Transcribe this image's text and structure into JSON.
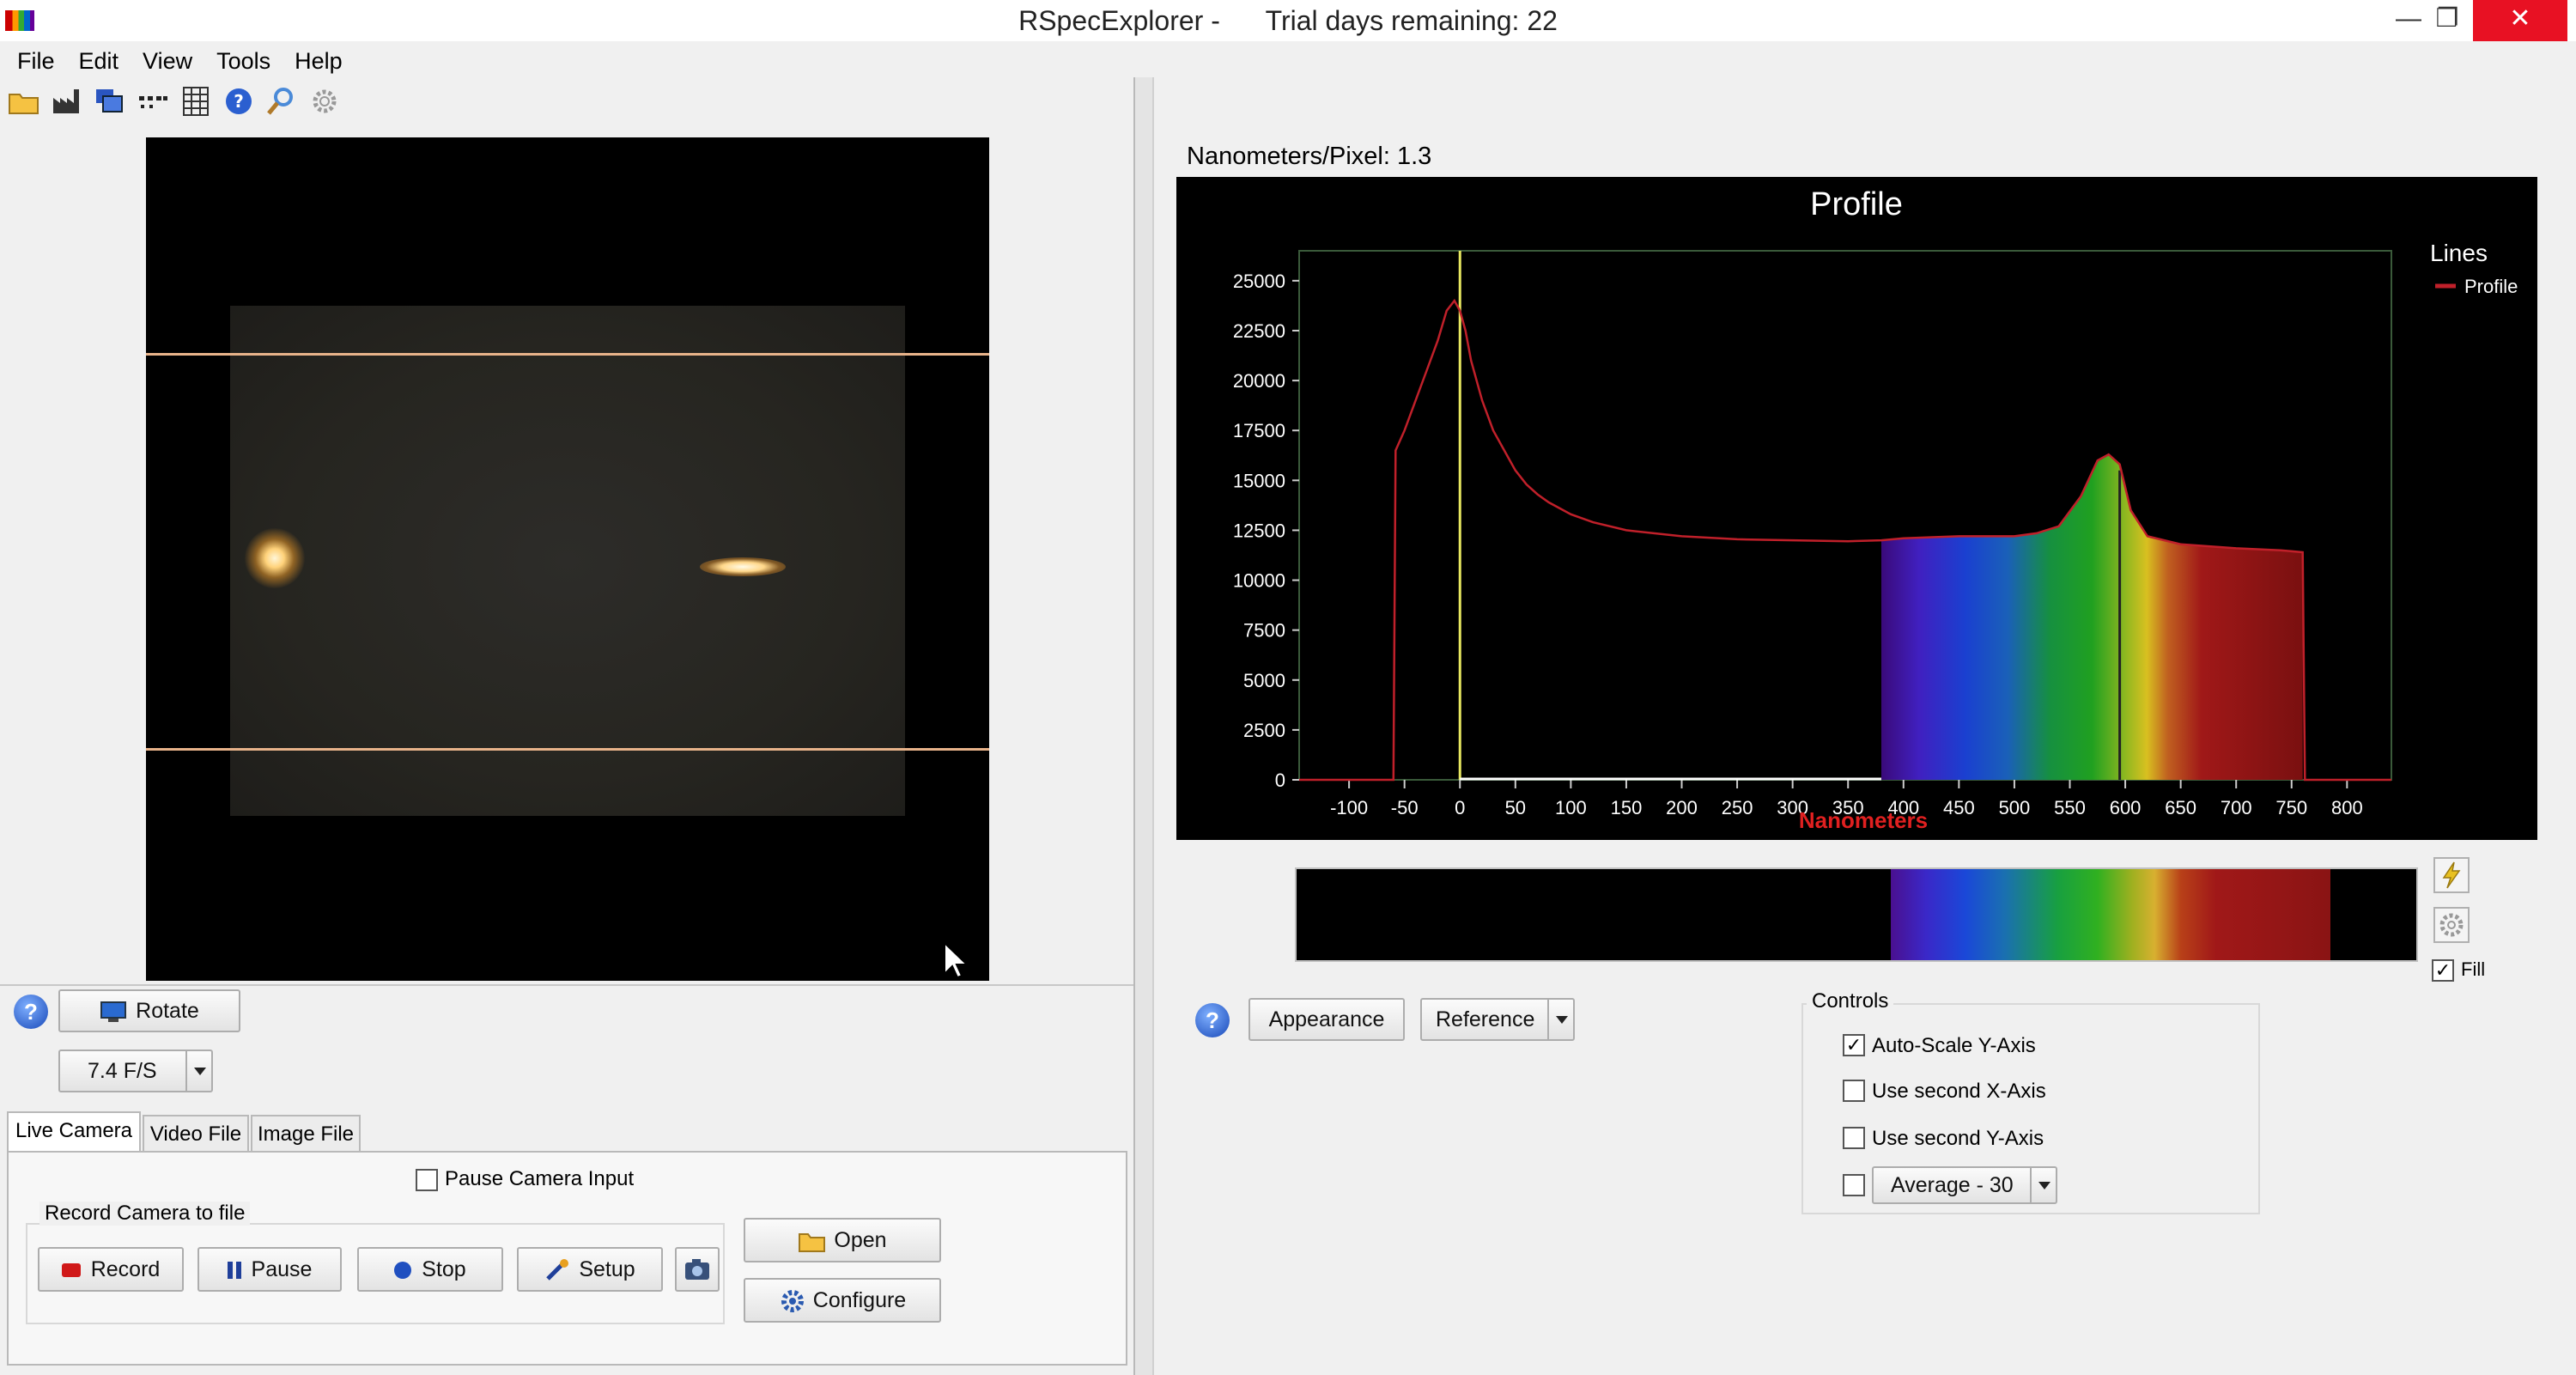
{
  "window": {
    "title": "RSpecExplorer -      Trial days remaining: 22",
    "minimize": "—",
    "maximize": "❐",
    "close": "✕"
  },
  "menu": [
    "File",
    "Edit",
    "View",
    "Tools",
    "Help"
  ],
  "left_toolbar_icons": [
    "open-folder-icon",
    "factory-icon",
    "copy-windows-icon",
    "dotted-line-icon",
    "grid-icon",
    "help-icon",
    "magnifier-icon",
    "gear-icon"
  ],
  "right_toolbar_icons": [
    "open-folder-icon",
    "dropdown-arrow-icon",
    "save-icon",
    "crosshair-icon",
    "copy-icon",
    "print-icon",
    "export-icon",
    "columns-icon",
    "vertical-arrows-icon",
    "triangle-marker-icon"
  ],
  "camera": {
    "rotate_label": "Rotate",
    "fps_value": "7.4 F/S",
    "tabs": [
      "Live Camera",
      "Video File",
      "Image File"
    ],
    "pause_input_label": "Pause Camera Input",
    "record_group_title": "Record Camera to file",
    "record_label": "Record",
    "pause_label": "Pause",
    "stop_label": "Stop",
    "setup_label": "Setup",
    "open_label": "Open",
    "configure_label": "Configure"
  },
  "profile": {
    "scale_label": "Nanometers/Pixel: 1.3",
    "appearance_label": "Appearance",
    "reference_label": "Reference",
    "fill_label": "Fill",
    "controls_title": "Controls",
    "controls": [
      {
        "label": "Auto-Scale Y-Axis",
        "checked": true
      },
      {
        "label": "Use second X-Axis",
        "checked": false
      },
      {
        "label": "Use second Y-Axis",
        "checked": false
      }
    ],
    "average_value": "Average - 30"
  },
  "chart_data": {
    "type": "line",
    "title": "Profile",
    "xlabel": "Nanometers",
    "ylabel": "",
    "xlim": [
      -145,
      840
    ],
    "ylim": [
      0,
      26500
    ],
    "x_ticks": [
      -100,
      -50,
      0,
      50,
      100,
      150,
      200,
      250,
      300,
      350,
      400,
      450,
      500,
      550,
      600,
      650,
      700,
      750,
      800
    ],
    "y_ticks": [
      0,
      2500,
      5000,
      7500,
      10000,
      12500,
      15000,
      17500,
      20000,
      22500,
      25000
    ],
    "legend_title": "Lines",
    "legend_placement": "top-right",
    "reference_line_x": 0,
    "marker_line_x": 595,
    "fill_range": [
      380,
      760
    ],
    "series": [
      {
        "name": "Profile",
        "color": "#c0202a",
        "x": [
          -145,
          -60,
          -58,
          -50,
          -40,
          -30,
          -20,
          -12,
          -5,
          0,
          5,
          10,
          20,
          30,
          40,
          50,
          60,
          70,
          80,
          100,
          120,
          150,
          200,
          250,
          300,
          350,
          380,
          400,
          450,
          500,
          520,
          540,
          560,
          575,
          585,
          595,
          605,
          620,
          650,
          700,
          740,
          760,
          762,
          840
        ],
        "y": [
          0,
          0,
          16500,
          17500,
          19000,
          20500,
          22000,
          23500,
          24000,
          23500,
          22500,
          21000,
          19000,
          17500,
          16500,
          15500,
          14800,
          14300,
          13900,
          13300,
          12900,
          12500,
          12200,
          12050,
          12000,
          11950,
          12000,
          12100,
          12200,
          12200,
          12350,
          12700,
          14200,
          16000,
          16300,
          15800,
          13500,
          12200,
          11800,
          11600,
          11500,
          11400,
          0,
          0
        ]
      }
    ]
  }
}
